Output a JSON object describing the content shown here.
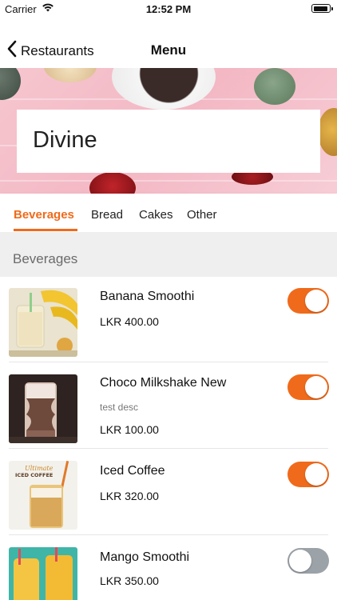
{
  "status_bar": {
    "carrier": "Carrier",
    "time": "12:52 PM"
  },
  "nav": {
    "back_label": "Restaurants",
    "title": "Menu"
  },
  "hero": {
    "restaurant_name": "Divine"
  },
  "tabs": [
    {
      "label": "Beverages",
      "active": true
    },
    {
      "label": "Bread",
      "active": false
    },
    {
      "label": "Cakes",
      "active": false
    },
    {
      "label": "Other",
      "active": false
    }
  ],
  "section": {
    "title": "Beverages"
  },
  "items": [
    {
      "name": "Banana Smoothi",
      "description": "",
      "price": "LKR 400.00",
      "available": true,
      "image": "banana-smoothie-image"
    },
    {
      "name": "Choco Milkshake New",
      "description": "test desc",
      "price": "LKR 100.00",
      "available": true,
      "image": "choco-milkshake-image"
    },
    {
      "name": "Iced Coffee",
      "description": "",
      "price": "LKR 320.00",
      "available": true,
      "image": "iced-coffee-image",
      "image_caption": [
        "Ultimate",
        "ICED COFFEE"
      ]
    },
    {
      "name": "Mango Smoothi",
      "description": "",
      "price": "LKR 350.00",
      "available": false,
      "image": "mango-smoothie-image"
    }
  ],
  "colors": {
    "accent": "#f06a1b",
    "toggle_off": "#9ba2a8",
    "section_bg": "#efefef",
    "hero_bg": "#f3b8c4"
  }
}
